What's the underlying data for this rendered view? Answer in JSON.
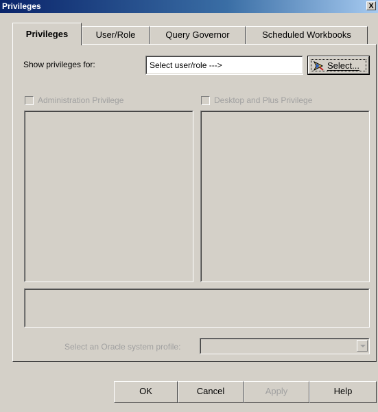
{
  "window": {
    "title": "Privileges",
    "close_label": "X"
  },
  "tabs": [
    {
      "label": "Privileges",
      "active": true
    },
    {
      "label": "User/Role",
      "active": false
    },
    {
      "label": "Query Governor",
      "active": false
    },
    {
      "label": "Scheduled Workbooks",
      "active": false
    }
  ],
  "privileges_tab": {
    "show_for_label": "Show privileges for:",
    "user_field_value": "Select user/role --->",
    "select_button_label": "Select...",
    "admin_privilege_label": "Administration Privilege",
    "desktop_privilege_label": "Desktop and Plus Privilege",
    "oracle_profile_label": "Select an Oracle system profile:",
    "oracle_profile_value": ""
  },
  "buttons": {
    "ok": "OK",
    "cancel": "Cancel",
    "apply": "Apply",
    "help": "Help"
  }
}
